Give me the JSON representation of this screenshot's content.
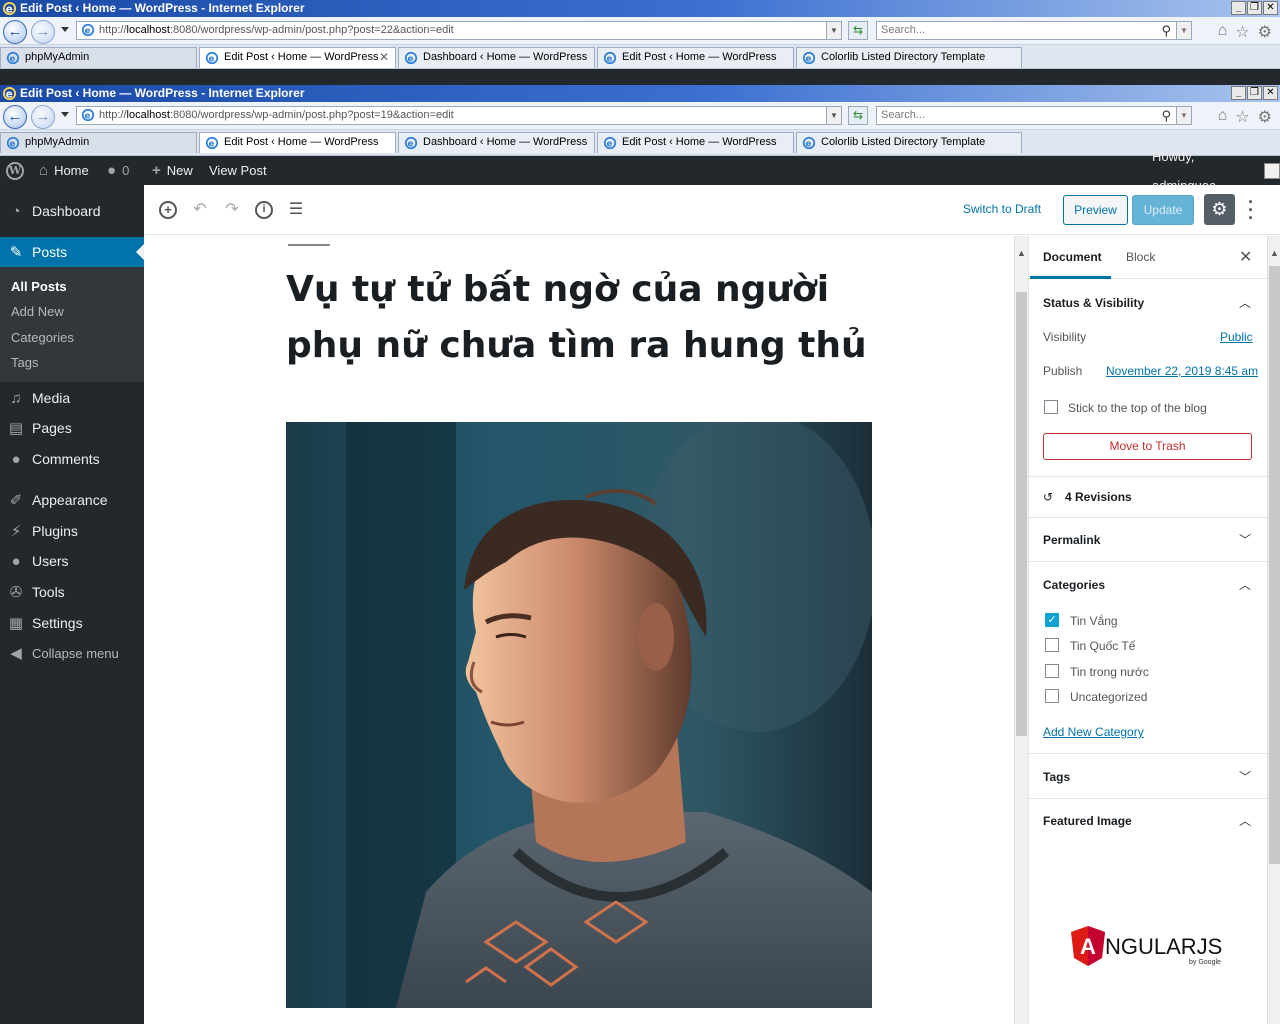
{
  "browser": {
    "back_window": {
      "title": "Edit Post ‹ Home — WordPress - Internet Explorer",
      "url_prefix": "http://",
      "url_host": "localhost",
      "url_rest": ":8080/wordpress/wp-admin/post.php?post=22&action=edit",
      "search_placeholder": "Search..."
    },
    "front_window": {
      "title": "Edit Post ‹ Home — WordPress - Internet Explorer",
      "url_prefix": "http://",
      "url_host": "localhost",
      "url_rest": ":8080/wordpress/wp-admin/post.php?post=19&action=edit",
      "search_placeholder": "Search..."
    },
    "tabs": [
      {
        "label": "phpMyAdmin"
      },
      {
        "label": "Edit Post ‹ Home — WordPress"
      },
      {
        "label": "Dashboard ‹ Home — WordPress"
      },
      {
        "label": "Edit Post ‹ Home — WordPress"
      },
      {
        "label": "Colorlib Listed Directory Template"
      }
    ],
    "window_buttons": [
      "_",
      "❐",
      "✕"
    ]
  },
  "admin_bar": {
    "home": "Home",
    "comments_count": "0",
    "new": "New",
    "view_post": "View Post",
    "howdy": "Howdy, adminquoc"
  },
  "menu": {
    "dashboard": "Dashboard",
    "posts": "Posts",
    "posts_sub": [
      "All Posts",
      "Add New",
      "Categories",
      "Tags"
    ],
    "media": "Media",
    "pages": "Pages",
    "comments": "Comments",
    "appearance": "Appearance",
    "plugins": "Plugins",
    "users": "Users",
    "tools": "Tools",
    "settings": "Settings",
    "collapse": "Collapse menu"
  },
  "editor": {
    "switch_to_draft": "Switch to Draft",
    "preview": "Preview",
    "update": "Update",
    "post_title": "Vụ tự tử bất ngờ của người phụ nữ chưa tìm ra hung thủ"
  },
  "sidebar": {
    "tab_document": "Document",
    "tab_block": "Block",
    "status_visibility": "Status & Visibility",
    "visibility_label": "Visibility",
    "visibility_value": "Public",
    "publish_label": "Publish",
    "publish_value": "November 22, 2019 8:45 am",
    "sticky_label": "Stick to the top of the blog",
    "move_to_trash": "Move to Trash",
    "revisions": "4 Revisions",
    "permalink": "Permalink",
    "categories_title": "Categories",
    "categories": [
      {
        "label": "Tin Vắng",
        "checked": true
      },
      {
        "label": "Tin Quốc Tế",
        "checked": false
      },
      {
        "label": "Tin trong nước",
        "checked": false
      },
      {
        "label": "Uncategorized",
        "checked": false
      }
    ],
    "add_new_category": "Add New Category",
    "tags": "Tags",
    "featured_image": "Featured Image",
    "angular_text": "NGULARJS",
    "angular_letter": "A",
    "angular_by": "by Google"
  },
  "colors": {
    "wp_blue": "#0073aa",
    "admin_dark": "#23282d",
    "trash_red": "#c62d2d",
    "angular_red": "#dd1b16"
  }
}
